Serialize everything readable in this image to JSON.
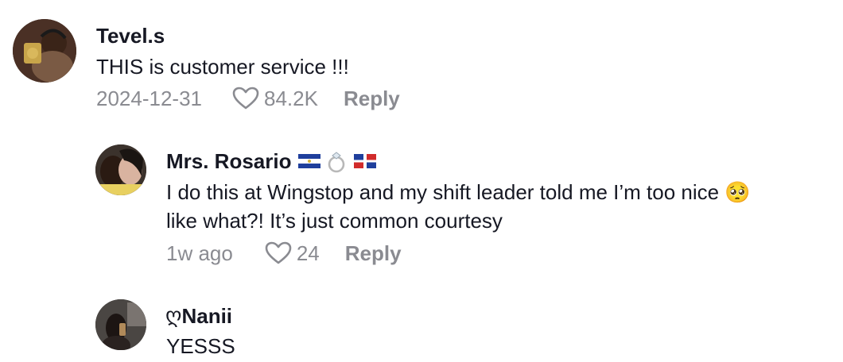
{
  "comments": [
    {
      "username": "Tevel.s",
      "text": "THIS is customer service !!!",
      "date": "2024-12-31",
      "likes": "84.2K",
      "reply_label": "Reply",
      "icons": [
        "avatar",
        "heart-outline-icon"
      ]
    },
    {
      "username": "Mrs. Rosario",
      "username_icons": [
        "el-salvador-flag-icon",
        "ring-icon",
        "dominican-republic-flag-icon"
      ],
      "text_line1": "I do this at Wingstop and my shift leader told me I’m too nice 🥺",
      "text_line2": "like what?! It’s just common courtesy",
      "date": "1w ago",
      "likes": "24",
      "reply_label": "Reply"
    },
    {
      "username_prefix": "ღ",
      "username": "Nanii",
      "text": "YESSS"
    }
  ],
  "colors": {
    "text": "#161823",
    "muted": "#8a8b91",
    "background": "#ffffff"
  }
}
